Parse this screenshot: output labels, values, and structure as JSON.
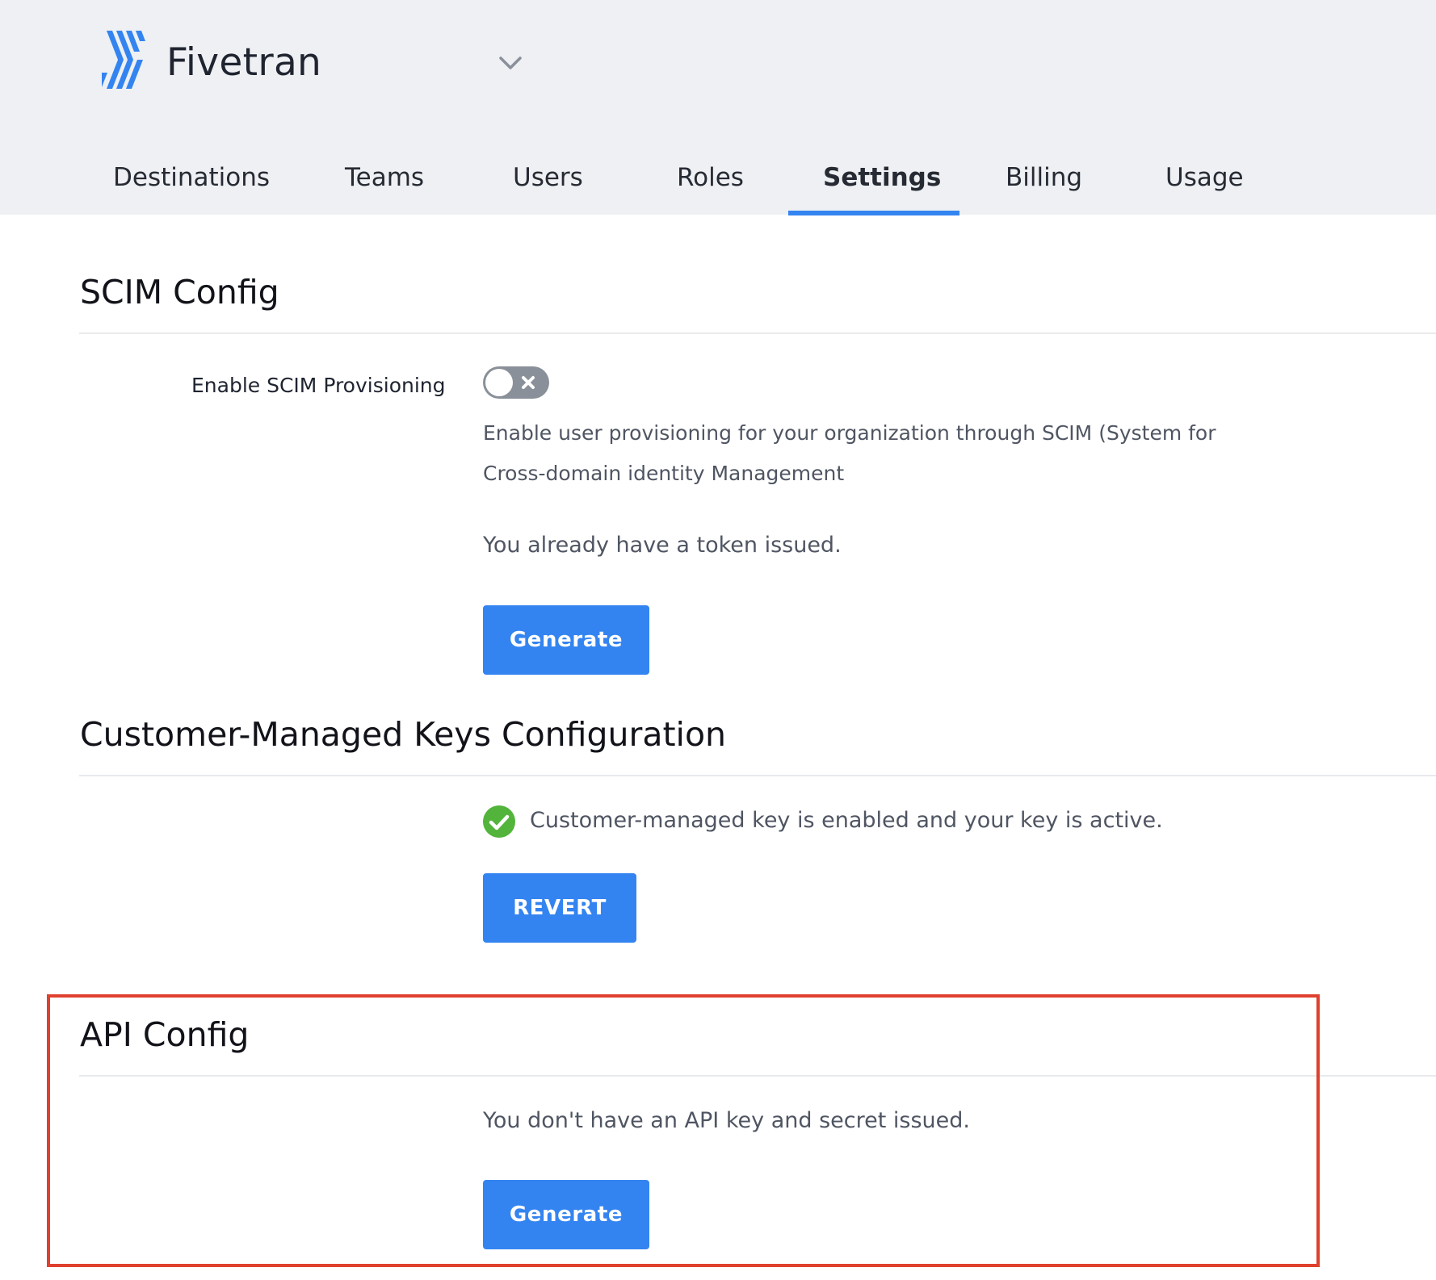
{
  "header": {
    "brand_name": "Fivetran",
    "logo_icon": "fivetran-logo",
    "chevron_icon": "chevron-down-icon",
    "accent_color": "#3384f0",
    "background_color": "#eef0f3"
  },
  "tabs": [
    {
      "label": "Destinations",
      "active": false
    },
    {
      "label": "Teams",
      "active": false
    },
    {
      "label": "Users",
      "active": false
    },
    {
      "label": "Roles",
      "active": false
    },
    {
      "label": "Settings",
      "active": true
    },
    {
      "label": "Billing",
      "active": false
    },
    {
      "label": "Usage",
      "active": false
    }
  ],
  "scim": {
    "title": "SCIM Config",
    "toggle_label": "Enable SCIM Provisioning",
    "toggle_on": false,
    "description_line1": "Enable user provisioning for your organization through SCIM (System for",
    "description_line2": "Cross-domain identity Management",
    "token_status": "You already have a token issued.",
    "button_label": "Generate"
  },
  "cmk": {
    "title": "Customer-Managed Keys Configuration",
    "status_icon": "check-circle-icon",
    "status_color": "#52b43a",
    "status_text": "Customer-managed key is enabled and your key is active.",
    "button_label": "REVERT"
  },
  "api": {
    "title": "API Config",
    "status_text": "You don't have an API key and secret issued.",
    "button_label": "Generate",
    "highlight_color": "#e0402e"
  }
}
